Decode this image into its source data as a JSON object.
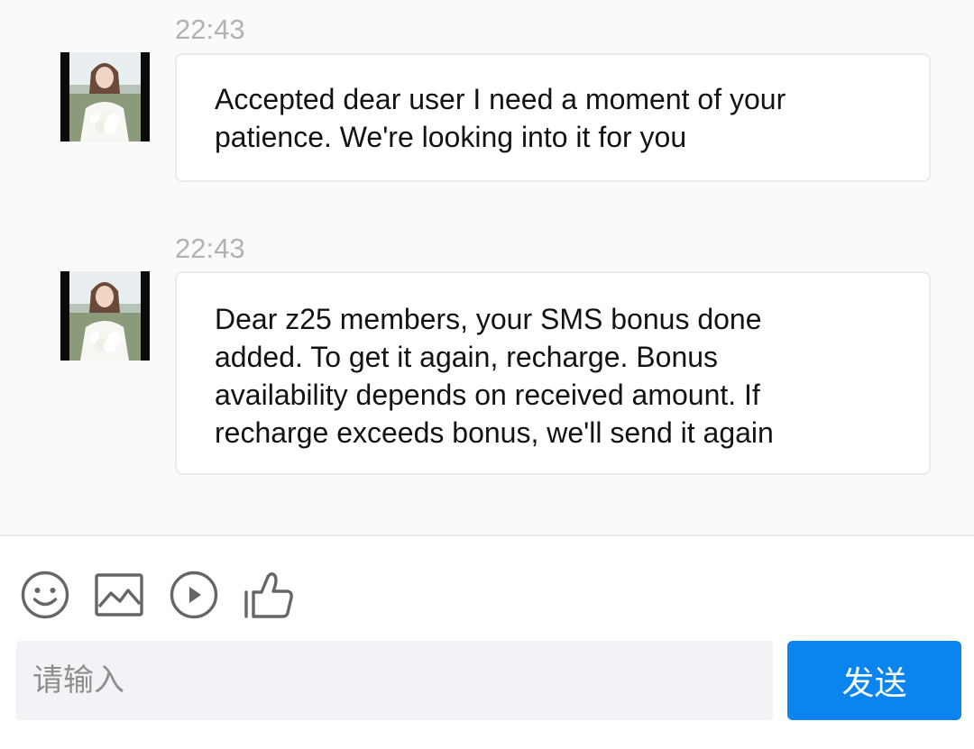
{
  "messages": [
    {
      "time": "22:43",
      "avatar": "bride-photo-avatar",
      "text_lines": [
        "Accepted dear user I need a moment of your",
        "patience. We're looking into it for you"
      ]
    },
    {
      "time": "22:43",
      "avatar": "bride-photo-avatar",
      "text_lines": [
        "Dear z25 members, your SMS bonus done",
        "added. To get it again, recharge. Bonus",
        "availability depends on received amount. If",
        "recharge exceeds bonus, we'll send it again"
      ]
    }
  ],
  "toolbar": {
    "icons": [
      "emoji-icon",
      "image-icon",
      "video-play-icon",
      "thumbs-up-icon"
    ]
  },
  "input": {
    "placeholder": "请输入",
    "value": ""
  },
  "send_button": {
    "label": "发送",
    "color": "#0a84ee"
  },
  "colors": {
    "chat_background": "#fafafb",
    "timestamp": "#b2b2b2",
    "icon_stroke": "#666666"
  }
}
